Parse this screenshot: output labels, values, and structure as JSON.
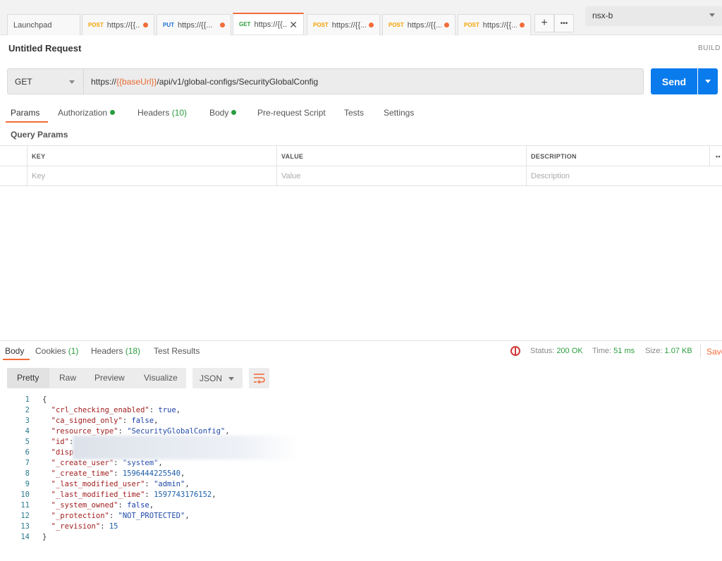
{
  "tabs": [
    {
      "label": "Launchpad",
      "method": "",
      "method_color": "",
      "url": "",
      "dot": false
    },
    {
      "label": "",
      "method": "POST",
      "method_color": "#f4a300",
      "url": "https://{{...",
      "dot": true
    },
    {
      "label": "",
      "method": "PUT",
      "method_color": "#1b6fd1",
      "url": "https://{{...",
      "dot": true
    },
    {
      "label": "",
      "method": "GET",
      "method_color": "#2a9d3e",
      "url": "https://{{...",
      "dot": false,
      "active": true
    },
    {
      "label": "",
      "method": "POST",
      "method_color": "#f4a300",
      "url": "https://{{...",
      "dot": true
    },
    {
      "label": "",
      "method": "POST",
      "method_color": "#f4a300",
      "url": "https://{{...",
      "dot": true
    },
    {
      "label": "",
      "method": "POST",
      "method_color": "#f4a300",
      "url": "https://{{...",
      "dot": true
    }
  ],
  "tab_actions": {
    "add": "+",
    "more": "•••",
    "close": "✕"
  },
  "environment": "nsx-b",
  "request": {
    "name": "Untitled Request",
    "build_label": "BUILD",
    "method": "GET",
    "url_prefix": "https://",
    "url_var": "{{baseUrl}}",
    "url_suffix": "/api/v1/global-configs/SecurityGlobalConfig",
    "send_label": "Send"
  },
  "request_tabs": {
    "params": "Params",
    "authorization": "Authorization",
    "headers": "Headers",
    "headers_count": "(10)",
    "body": "Body",
    "prerequest": "Pre-request Script",
    "tests": "Tests",
    "settings": "Settings"
  },
  "query_params": {
    "title": "Query Params",
    "headers": {
      "key": "KEY",
      "value": "VALUE",
      "description": "DESCRIPTION",
      "more": "••"
    },
    "placeholders": {
      "key": "Key",
      "value": "Value",
      "description": "Description"
    }
  },
  "response_tabs": {
    "body": "Body",
    "cookies": "Cookies",
    "cookies_count": "(1)",
    "headers": "Headers",
    "headers_count": "(18)",
    "test_results": "Test Results"
  },
  "response_status": {
    "status_label": "Status:",
    "status_value": "200 OK",
    "time_label": "Time:",
    "time_value": "51 ms",
    "size_label": "Size:",
    "size_value": "1.07 KB",
    "save_label": "Save"
  },
  "view_options": {
    "pretty": "Pretty",
    "raw": "Raw",
    "preview": "Preview",
    "visualize": "Visualize",
    "format": "JSON"
  },
  "code_lines": [
    {
      "n": "1",
      "html": "{"
    },
    {
      "n": "2",
      "html": "  <span class=\"k\">\"crl_checking_enabled\"</span>: <span class=\"b\">true</span>,"
    },
    {
      "n": "3",
      "html": "  <span class=\"k\">\"ca_signed_only\"</span>: <span class=\"b\">false</span>,"
    },
    {
      "n": "4",
      "html": "  <span class=\"k\">\"resource_type\"</span>: <span class=\"s\">\"SecurityGlobalConfig\"</span>,"
    },
    {
      "n": "5",
      "html": "  <span class=\"k\">\"id\"</span>:"
    },
    {
      "n": "6",
      "html": "  <span class=\"k\">\"displ</span>"
    },
    {
      "n": "7",
      "html": "  <span class=\"k\">\"_create_user\"</span>: <span class=\"s\">\"system\"</span>,"
    },
    {
      "n": "8",
      "html": "  <span class=\"k\">\"_create_time\"</span>: <span class=\"n\">1596444225540</span>,"
    },
    {
      "n": "9",
      "html": "  <span class=\"k\">\"_last_modified_user\"</span>: <span class=\"s\">\"admin\"</span>,"
    },
    {
      "n": "10",
      "html": "  <span class=\"k\">\"_last_modified_time\"</span>: <span class=\"n\">1597743176152</span>,"
    },
    {
      "n": "11",
      "html": "  <span class=\"k\">\"_system_owned\"</span>: <span class=\"b\">false</span>,"
    },
    {
      "n": "12",
      "html": "  <span class=\"k\">\"_protection\"</span>: <span class=\"s\">\"NOT_PROTECTED\"</span>,"
    },
    {
      "n": "13",
      "html": "  <span class=\"k\">\"_revision\"</span>: <span class=\"n\">15</span>"
    },
    {
      "n": "14",
      "html": "}"
    }
  ],
  "colors": {
    "accent": "#f26b3a",
    "send": "#097bed",
    "success": "#2a9d3e"
  }
}
